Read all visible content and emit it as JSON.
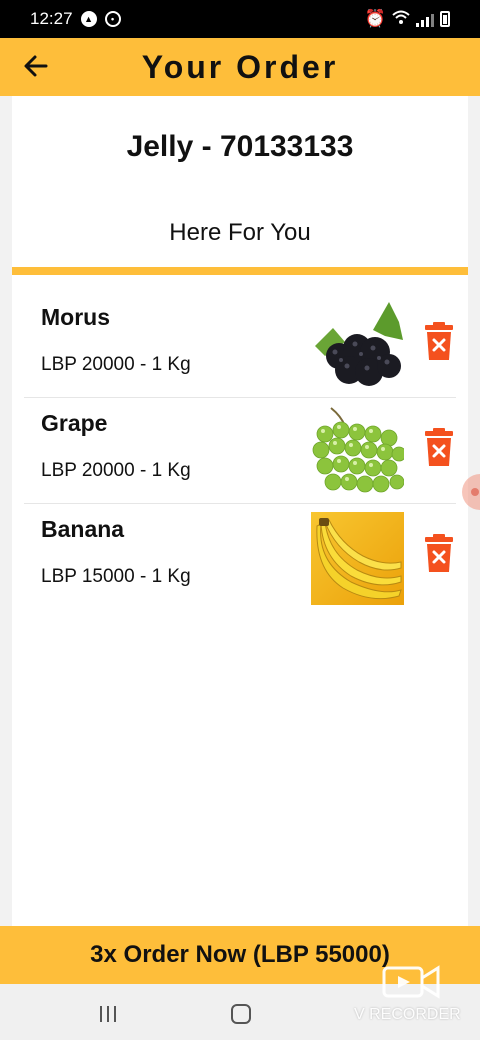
{
  "status_bar": {
    "time": "12:27"
  },
  "app_bar": {
    "title": "Your Order"
  },
  "store": {
    "name": "Jelly - 70133133",
    "tagline": "Here For You"
  },
  "items": [
    {
      "name": "Morus",
      "price": "LBP 20000 - 1 Kg",
      "image": "blackberry"
    },
    {
      "name": "Grape",
      "price": "LBP 20000 - 1 Kg",
      "image": "green-grapes"
    },
    {
      "name": "Banana",
      "price": "LBP 15000 - 1 Kg",
      "image": "banana"
    }
  ],
  "order_button": {
    "label": "3x Order Now (LBP 55000)"
  },
  "watermark": {
    "text": "V RECORDER"
  },
  "colors": {
    "accent": "#FEBE3A",
    "delete": "#F4511E"
  }
}
